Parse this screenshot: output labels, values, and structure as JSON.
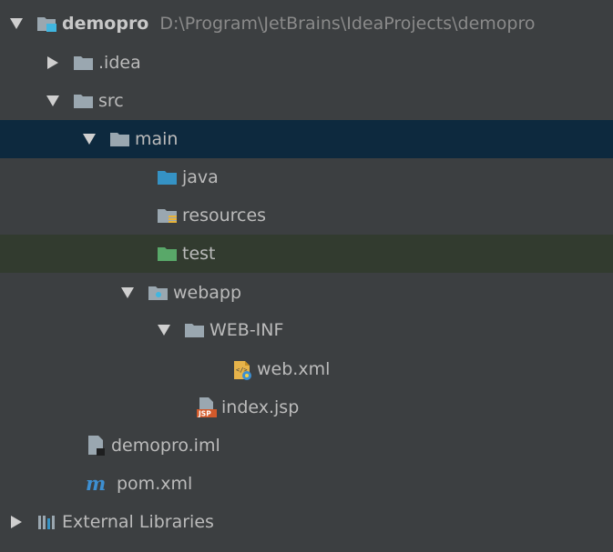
{
  "project": {
    "name": "demopro",
    "path": "D:\\Program\\JetBrains\\IdeaProjects\\demopro"
  },
  "nodes": {
    "idea": ".idea",
    "src": "src",
    "main": "main",
    "java": "java",
    "resources": "resources",
    "test": "test",
    "webapp": "webapp",
    "webinf": "WEB-INF",
    "webxml": "web.xml",
    "indexjsp": "index.jsp",
    "iml": "demopro.iml",
    "pom": "pom.xml",
    "extlibs": "External Libraries"
  },
  "icons": {
    "jsp_badge": "JSP",
    "maven_mark": "m"
  },
  "colors": {
    "selected_row": "#0d293e",
    "highlight_row": "#323b2f",
    "folder": "#9aa7b0",
    "source_folder": "#3592c4",
    "test_folder": "#59a869",
    "module_folder": "#40b6e0"
  }
}
